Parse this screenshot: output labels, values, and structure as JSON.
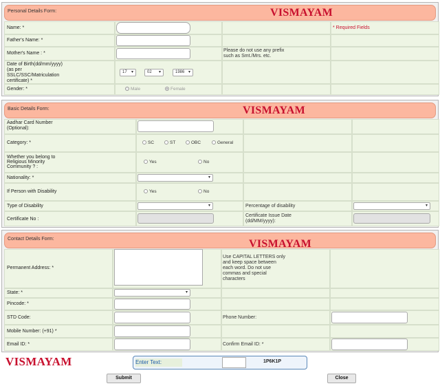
{
  "brand": "VISMAYAM",
  "personal": {
    "title": "Personal Details Form:",
    "required_note": "* Required Fields",
    "name_label": "Name: *",
    "father_label": "Father's Name: *",
    "mother_label": "Mother's Name : *",
    "mother_note_1": "Please do not use any prefix",
    "mother_note_2": "such as Smt./Mrs. etc.",
    "dob_label_1": "Date of Birth(dd/mm/yyyy)",
    "dob_label_2": "(as per",
    "dob_label_3": "SSLC/SSC/Matriculation",
    "dob_label_4": "certificate) *",
    "dob_day": "17",
    "dob_month": "02",
    "dob_year": "1986",
    "gender_label": "Gender: *",
    "gender_male": "Male",
    "gender_female": "Female"
  },
  "basic": {
    "title": "Basic Details Form:",
    "aadhar_label_1": "Aadhar Card Number",
    "aadhar_label_2": "(Optional):",
    "category_label": "Category: *",
    "cat_sc": "SC",
    "cat_st": "ST",
    "cat_obc": "OBC",
    "cat_general": "General",
    "minority_label_1": "Whether you belong to",
    "minority_label_2": "Religious Minority",
    "minority_label_3": "Community ? :",
    "yes": "Yes",
    "no": "No",
    "nationality_label": "Nationality: *",
    "disability_label": "If Person with Disability",
    "disability_type_label": "Type of Disability",
    "percentage_label": "Percentage of disability",
    "cert_no_label": "Certificate No :",
    "cert_date_label_1": "Certificate Issue Date",
    "cert_date_label_2": "(dd/MM/yyyy):"
  },
  "contact": {
    "title": "Contact Details Form:",
    "address_label": "Permanent Address: *",
    "address_note_1": "Use CAPITAL LETTERS only",
    "address_note_2": "and keep space between",
    "address_note_3": "each word. Do not use",
    "address_note_4": "commas and special",
    "address_note_5": "characters",
    "state_label": "State: *",
    "pincode_label": "Pincode: *",
    "std_label": "STD Code:",
    "phone_label": "Phone Number:",
    "mobile_label": "Mobile Number: (+91) *",
    "email_label": "Email ID: *",
    "confirm_email_label": "Confirm Email ID: *"
  },
  "captcha": {
    "label": "Enter Text:",
    "code": "1P6K1P"
  },
  "buttons": {
    "submit": "Submit",
    "close": "Close"
  }
}
